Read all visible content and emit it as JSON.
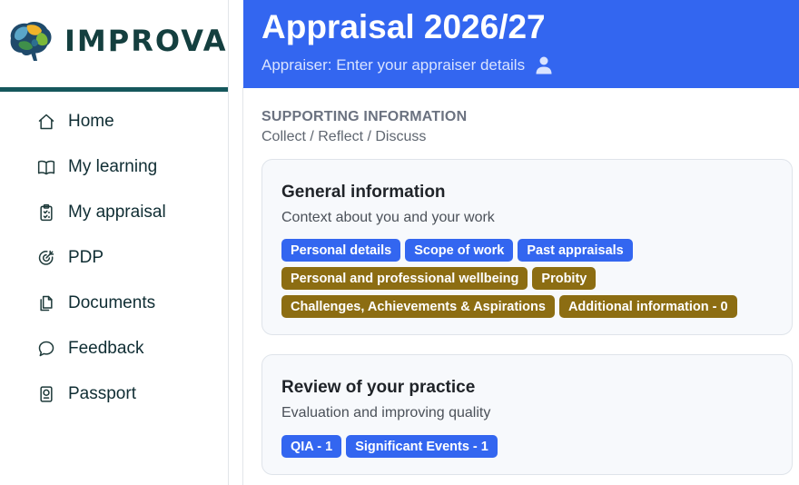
{
  "brand": {
    "name": "IMPROVAL"
  },
  "nav": [
    {
      "label": "Home",
      "icon": "home-icon"
    },
    {
      "label": "My learning",
      "icon": "book-icon"
    },
    {
      "label": "My appraisal",
      "icon": "clipboard-icon"
    },
    {
      "label": "PDP",
      "icon": "target-icon"
    },
    {
      "label": "Documents",
      "icon": "documents-icon"
    },
    {
      "label": "Feedback",
      "icon": "chat-bubble-icon"
    },
    {
      "label": "Passport",
      "icon": "passport-icon"
    }
  ],
  "header": {
    "title": "Appraisal 2026/27",
    "appraiser_text": "Appraiser: Enter your appraiser details",
    "appraiser_icon": "user-icon"
  },
  "section": {
    "heading": "SUPPORTING INFORMATION",
    "subheading": "Collect / Reflect / Discuss"
  },
  "cards": [
    {
      "title": "General information",
      "description": "Context about you and your work",
      "tag_rows": [
        [
          {
            "label": "Personal details",
            "color": "#3366f0"
          },
          {
            "label": "Scope of work",
            "color": "#3366f0"
          },
          {
            "label": "Past appraisals",
            "color": "#3366f0"
          }
        ],
        [
          {
            "label": "Personal and professional wellbeing",
            "color": "#8c6d12"
          },
          {
            "label": "Probity",
            "color": "#8c6d12"
          }
        ],
        [
          {
            "label": "Challenges, Achievements & Aspirations",
            "color": "#8c6d12"
          },
          {
            "label": "Additional information - 0",
            "color": "#8c6d12"
          }
        ]
      ]
    },
    {
      "title": "Review of your practice",
      "description": "Evaluation and improving quality",
      "tag_rows": [
        [
          {
            "label": "QIA - 1",
            "color": "#3366f0"
          },
          {
            "label": "Significant Events - 1",
            "color": "#3366f0"
          }
        ]
      ]
    }
  ],
  "colors": {
    "header_bg": "#3366f0",
    "brand_text": "#143f3f",
    "brand_bar": "#15575c",
    "tag_blue": "#3366f0",
    "tag_gold": "#8c6d12"
  }
}
